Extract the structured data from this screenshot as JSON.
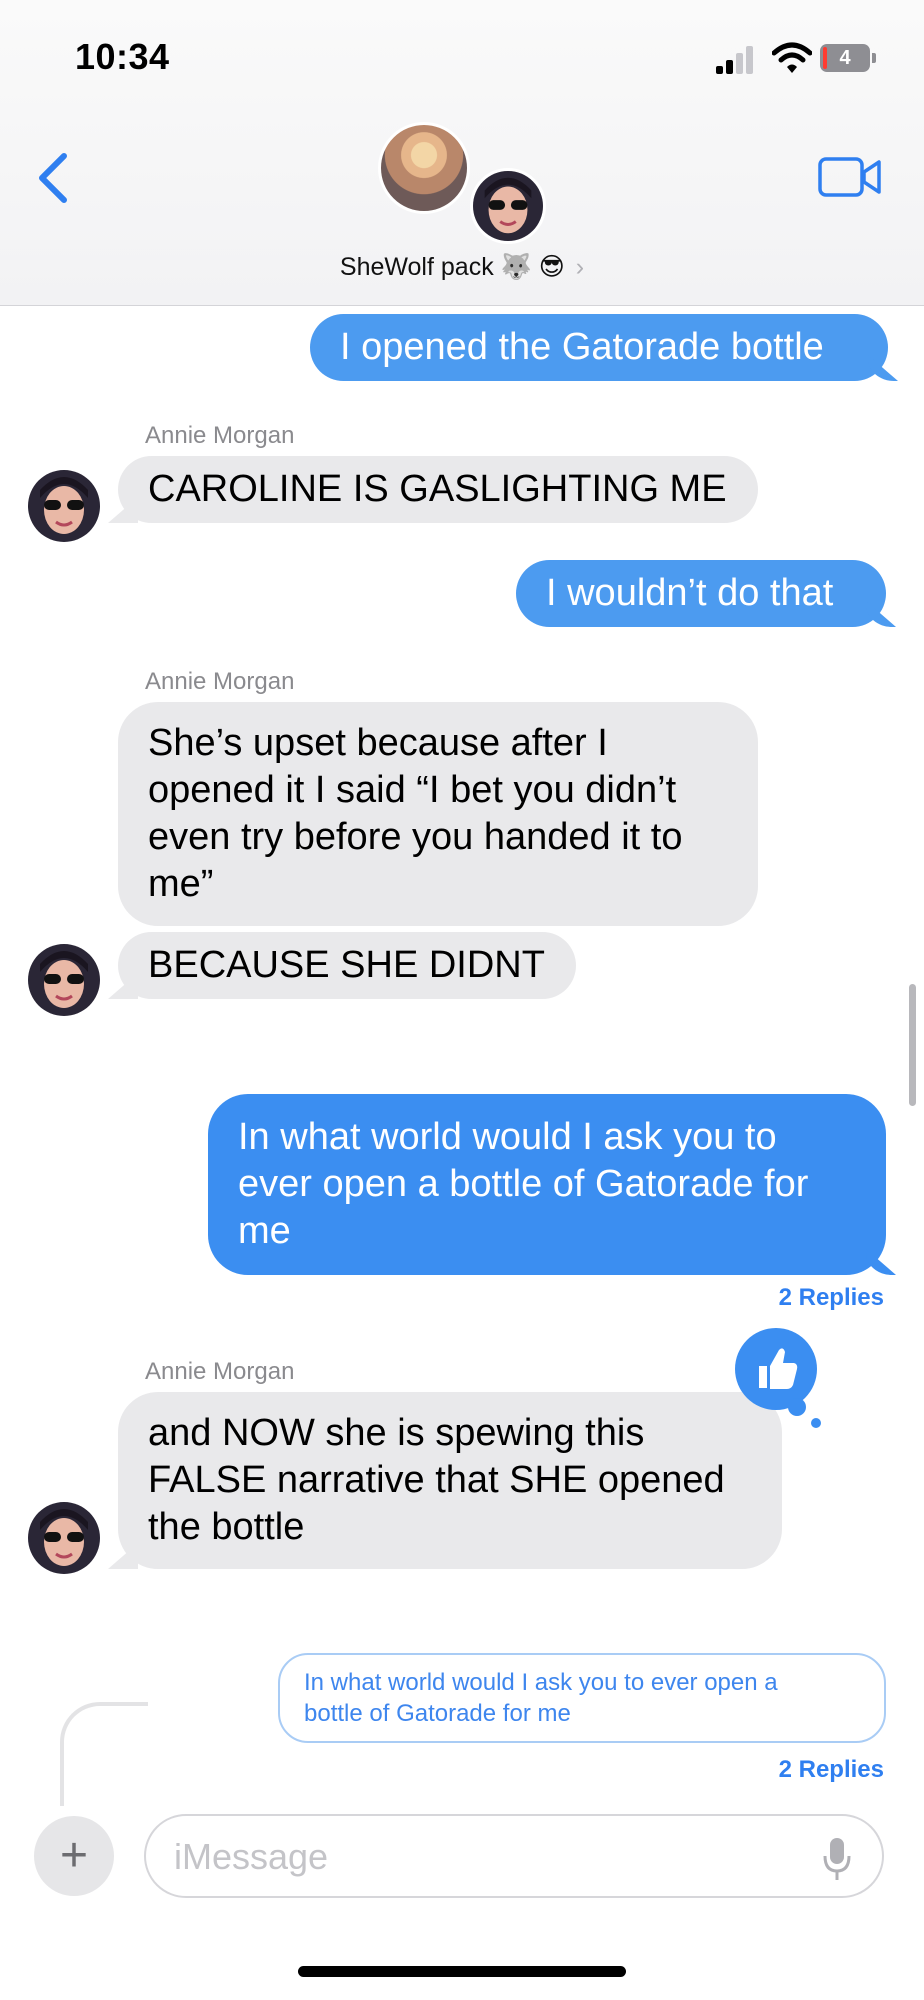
{
  "status_bar": {
    "time": "10:34",
    "battery": "4"
  },
  "header": {
    "group_name": "SheWolf pack",
    "group_emoji": "🐺 😎",
    "chevron": "›"
  },
  "messages": [
    {
      "type": "outgoing",
      "text": "I opened the Gatorade bottle"
    },
    {
      "type": "sender",
      "text": "Annie Morgan"
    },
    {
      "type": "incoming",
      "text": "CAROLINE IS GASLIGHTING ME"
    },
    {
      "type": "outgoing",
      "text": "I wouldn’t do that"
    },
    {
      "type": "sender",
      "text": "Annie Morgan"
    },
    {
      "type": "incoming",
      "lines": [
        "She’s upset because after I",
        "opened it I said “I bet you didn’t",
        "even try before you handed it to",
        "me”"
      ]
    },
    {
      "type": "incoming",
      "text": "BECAUSE SHE DIDNT"
    },
    {
      "type": "outgoing",
      "lines": [
        "In what world would I ask you to",
        "ever open a bottle of Gatorade for",
        "me"
      ]
    },
    {
      "type": "replies",
      "text": "2 Replies"
    },
    {
      "type": "sender",
      "text": "Annie Morgan"
    },
    {
      "type": "incoming",
      "lines": [
        "and NOW she is spewing this",
        "FALSE narrative that SHE opened",
        "the bottle"
      ]
    },
    {
      "type": "quote",
      "lines": [
        "In what world would I ask you to ever open a",
        "bottle of Gatorade for me"
      ]
    },
    {
      "type": "replies",
      "text": "2 Replies"
    }
  ],
  "reaction": {
    "icon": "thumbs-up-icon",
    "color": "#3b8ef1"
  },
  "input_bar": {
    "placeholder": "iMessage",
    "plus_label": "+"
  },
  "colors": {
    "outgoing": "#4c9bf0",
    "incoming": "#e9e9eb",
    "accent": "#2f7ff0"
  }
}
